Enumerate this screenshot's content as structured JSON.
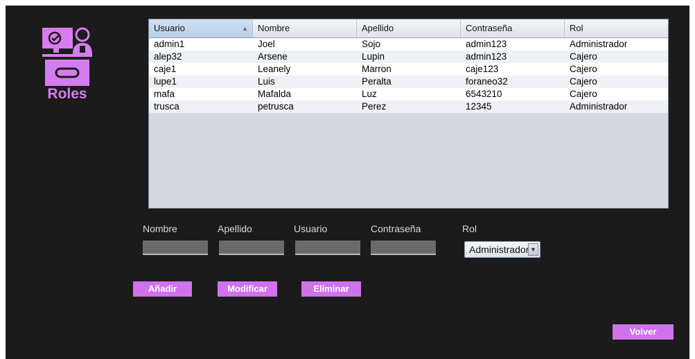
{
  "logo": {
    "title": "Roles",
    "icon": "computer-user-icon",
    "accent": "#d77cf0"
  },
  "table": {
    "columns": [
      "Usuario",
      "Nombre",
      "Apellido",
      "Contraseña",
      "Rol"
    ],
    "sorted_column": "Usuario",
    "sort_direction": "ascending",
    "rows": [
      [
        "admin1",
        "Joel",
        "Sojo",
        "admin123",
        "Administrador"
      ],
      [
        "alep32",
        "Arsene",
        "Lupin",
        "admin123",
        "Cajero"
      ],
      [
        "caje1",
        "Leanely",
        "Marron",
        "caje123",
        "Cajero"
      ],
      [
        "lupe1",
        "Luis",
        "Peralta",
        "foraneo32",
        "Cajero"
      ],
      [
        "mafa",
        "Mafalda",
        "Luz",
        "6543210",
        "Cajero"
      ],
      [
        "trusca",
        "petrusca",
        "Perez",
        "12345",
        "Administrador"
      ]
    ]
  },
  "form": {
    "nombre_label": "Nombre",
    "apellido_label": "Apellido",
    "usuario_label": "Usuario",
    "contrasena_label": "Contraseña",
    "rol_label": "Rol",
    "nombre_value": "",
    "apellido_value": "",
    "usuario_value": "",
    "contrasena_value": "",
    "rol_selected": "Administrador"
  },
  "buttons": {
    "add": "Añadir",
    "modify": "Modificar",
    "delete": "Eliminar",
    "back": "Volver"
  },
  "colors": {
    "background": "#1b1b1b",
    "button": "#cf72ec"
  }
}
